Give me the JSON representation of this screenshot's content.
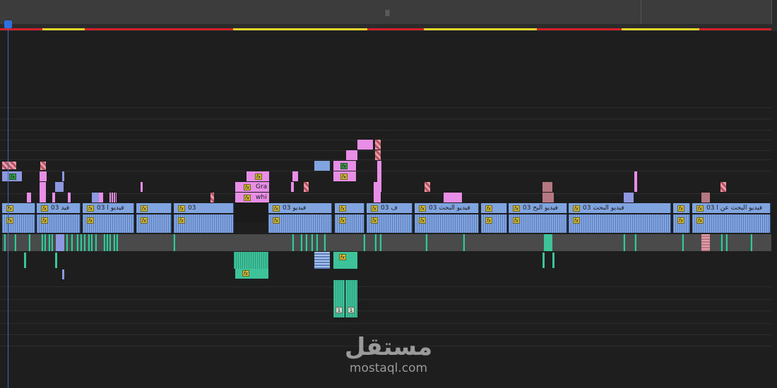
{
  "app": {
    "panel": "timeline-sequence"
  },
  "ruler": {
    "grip_label": "|||"
  },
  "colors": {
    "video_clip": "#7fa4e0",
    "audio_clip": "#3ec29a",
    "graphic_clip": "#e98ee6",
    "nested_clip": "#8d98e0",
    "adjustment_clip": "#b57883",
    "work_area_red": "#d0202a",
    "work_area_yellow": "#e6d52a",
    "playhead": "#2f6fe0"
  },
  "icons": {
    "fx": "fx-badge-icon",
    "sync": "sync-number-icon"
  },
  "timeline": {
    "video1_labels": [
      {
        "text": "03 فيد",
        "badge": "fx"
      },
      {
        "text": "03 فيديو ا",
        "badge": "fx"
      },
      {
        "text": "03",
        "badge": "fx"
      },
      {
        "text": "03 فيديو",
        "badge": "fx"
      },
      {
        "text": "03 ف",
        "badge": "fx"
      },
      {
        "text": "03 فيديو البحث",
        "badge": "fx"
      },
      {
        "text": "03 فيديو البح",
        "badge": "fx"
      },
      {
        "text": "03 فيديو البحث",
        "badge": "fx"
      },
      {
        "text": "03 فيديو البحث عن ا",
        "badge": "fx"
      }
    ],
    "graphic_labels": [
      {
        "text": "Gra",
        "badge": "fx"
      },
      {
        "text": "whi",
        "badge": "fx"
      }
    ],
    "audio_sync_numbers": [
      "1",
      "1"
    ]
  },
  "watermark": {
    "arabic": "مستقل",
    "latin": "mostaql.com"
  }
}
